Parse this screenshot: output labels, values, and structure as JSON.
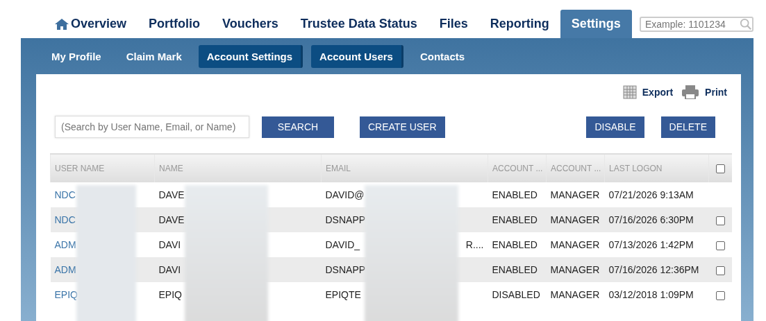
{
  "nav": {
    "tabs": [
      {
        "label": "Overview",
        "kind": "home",
        "selected": false
      },
      {
        "label": "Portfolio",
        "selected": false
      },
      {
        "label": "Vouchers",
        "selected": false
      },
      {
        "label": "Trustee Data Status",
        "selected": false
      },
      {
        "label": "Files",
        "selected": false
      },
      {
        "label": "Reporting",
        "selected": false
      },
      {
        "label": "Settings",
        "selected": true
      }
    ],
    "search": {
      "placeholder": "Example: 1101234"
    }
  },
  "subnav": [
    {
      "label": "My Profile",
      "selected": false
    },
    {
      "label": "Claim Mark",
      "selected": false
    },
    {
      "label": "Account Settings",
      "selected": true
    },
    {
      "label": "Account Users",
      "selected": true
    },
    {
      "label": "Contacts",
      "selected": false
    }
  ],
  "tools": [
    {
      "label": "Export",
      "kind": "export"
    },
    {
      "label": "Print",
      "kind": "print"
    }
  ],
  "search": {
    "placeholder": "(Search by User Name, Email, or Name)",
    "button": "SEARCH"
  },
  "create_button": "CREATE USER",
  "actions": [
    "DISABLE",
    "DELETE"
  ],
  "table": {
    "columns": [
      "USER NAME",
      "NAME",
      "EMAIL",
      "ACCOUNT ...",
      "ACCOUNT ...",
      "LAST LOGON"
    ],
    "header_checked": false,
    "rows": [
      {
        "user": "NDC",
        "name": "DAVE",
        "email": "DAVID@",
        "status": "ENABLED",
        "role": "MANAGER",
        "logon": "07/21/2026 9:13AM"
      },
      {
        "user": "NDC",
        "name": "DAVE",
        "email": "DSNAPP",
        "status": "ENABLED",
        "role": "MANAGER",
        "logon": "07/16/2026 6:30PM",
        "checked": false
      },
      {
        "user": "ADM",
        "name": "DAVI",
        "email": "DAVID_",
        "email_tail": "R....",
        "status": "ENABLED",
        "role": "MANAGER",
        "logon": "07/13/2026 1:42PM",
        "checked": false
      },
      {
        "user": "ADM",
        "name": "DAVI",
        "email": "DSNAPP",
        "status": "ENABLED",
        "role": "MANAGER",
        "logon": "07/16/2026 12:36PM",
        "checked": false
      },
      {
        "user": "EPIQ",
        "name": "EPIQ",
        "email": "EPIQTE",
        "status": "DISABLED",
        "role": "MANAGER",
        "logon": "03/12/2018 1:09PM",
        "checked": false
      }
    ]
  }
}
